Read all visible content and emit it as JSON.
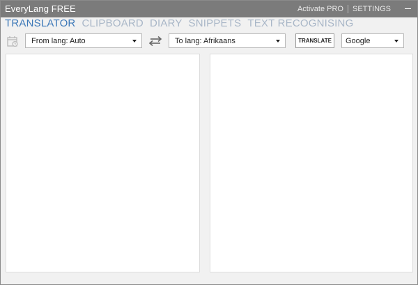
{
  "window": {
    "title": "EveryLang FREE",
    "activate_label": "Activate PRO",
    "settings_label": "SETTINGS",
    "minimize_icon": "minimize-icon"
  },
  "tabs": [
    {
      "label": "TRANSLATOR",
      "active": true
    },
    {
      "label": "CLIPBOARD",
      "active": false
    },
    {
      "label": "DIARY",
      "active": false
    },
    {
      "label": "SNIPPETS",
      "active": false
    },
    {
      "label": "TEXT RECOGNISING",
      "active": false
    }
  ],
  "toolbar": {
    "history_icon": "history-icon",
    "from_lang": "From lang: Auto",
    "swap_icon": "swap-arrows-icon",
    "to_lang": "To lang: Afrikaans",
    "translate_label": "TRANSLATE",
    "service": "Google"
  },
  "panels": {
    "source_text": "",
    "result_text": ""
  },
  "colors": {
    "titlebar": "#7b7b7b",
    "tab_active": "#3c78b8",
    "tab_inactive": "#a8b6c7",
    "background": "#f1f1f1"
  }
}
